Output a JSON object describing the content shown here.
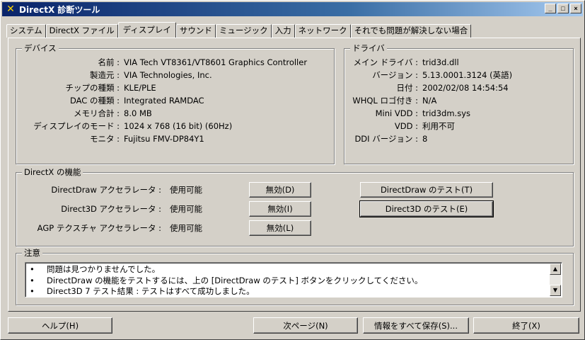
{
  "window": {
    "title": "DirectX 診断ツール",
    "controls": {
      "minimize": "_",
      "maximize": "□",
      "close": "×"
    }
  },
  "tabs": [
    {
      "label": "システム"
    },
    {
      "label": "DirectX ファイル"
    },
    {
      "label": "ディスプレイ",
      "active": true
    },
    {
      "label": "サウンド"
    },
    {
      "label": "ミュージック"
    },
    {
      "label": "入力"
    },
    {
      "label": "ネットワーク"
    },
    {
      "label": "それでも問題が解決しない場合"
    }
  ],
  "device": {
    "title": "デバイス",
    "rows": [
      {
        "label": "名前 :",
        "value": "VIA Tech VT8361/VT8601 Graphics Controller"
      },
      {
        "label": "製造元 :",
        "value": "VIA Technologies, Inc."
      },
      {
        "label": "チップの種類 :",
        "value": "KLE/PLE"
      },
      {
        "label": "DAC の種類 :",
        "value": "Integrated RAMDAC"
      },
      {
        "label": "メモリ合計 :",
        "value": "8.0 MB"
      },
      {
        "label": "ディスプレイのモード :",
        "value": "1024 x 768 (16 bit) (60Hz)"
      },
      {
        "label": "モニタ :",
        "value": "Fujitsu FMV-DP84Y1"
      }
    ]
  },
  "driver": {
    "title": "ドライバ",
    "rows": [
      {
        "label": "メイン ドライバ :",
        "value": "trid3d.dll"
      },
      {
        "label": "バージョン :",
        "value": "5.13.0001.3124 (英語)"
      },
      {
        "label": "日付 :",
        "value": "2002/02/08 14:54:54"
      },
      {
        "label": "WHQL ロゴ付き :",
        "value": "N/A"
      },
      {
        "label": "Mini VDD :",
        "value": "trid3dm.sys"
      },
      {
        "label": "VDD :",
        "value": "利用不可"
      },
      {
        "label": "DDI バージョン :",
        "value": "8"
      }
    ]
  },
  "features": {
    "title": "DirectX の機能",
    "rows": [
      {
        "label": "DirectDraw アクセラレータ :",
        "status": "使用可能",
        "disable_label": "無効(D)",
        "test_label": "DirectDraw のテスト(T)"
      },
      {
        "label": "Direct3D アクセラレータ :",
        "status": "使用可能",
        "disable_label": "無効(I)",
        "test_label": "Direct3D のテスト(E)"
      },
      {
        "label": "AGP テクスチャ アクセラレータ :",
        "status": "使用可能",
        "disable_label": "無効(L)"
      }
    ]
  },
  "notes": {
    "title": "注意",
    "bullet": "•",
    "items": [
      "問題は見つかりませんでした。",
      "DirectDraw の機能をテストするには、上の [DirectDraw のテスト] ボタンをクリックしてください。",
      "Direct3D 7 テスト結果 : テストはすべて成功しました。"
    ],
    "scroll_up": "▲",
    "scroll_down": "▼"
  },
  "footer": {
    "help": "ヘルプ(H)",
    "next": "次ページ(N)",
    "save_all": "情報をすべて保存(S)...",
    "exit": "終了(X)"
  }
}
